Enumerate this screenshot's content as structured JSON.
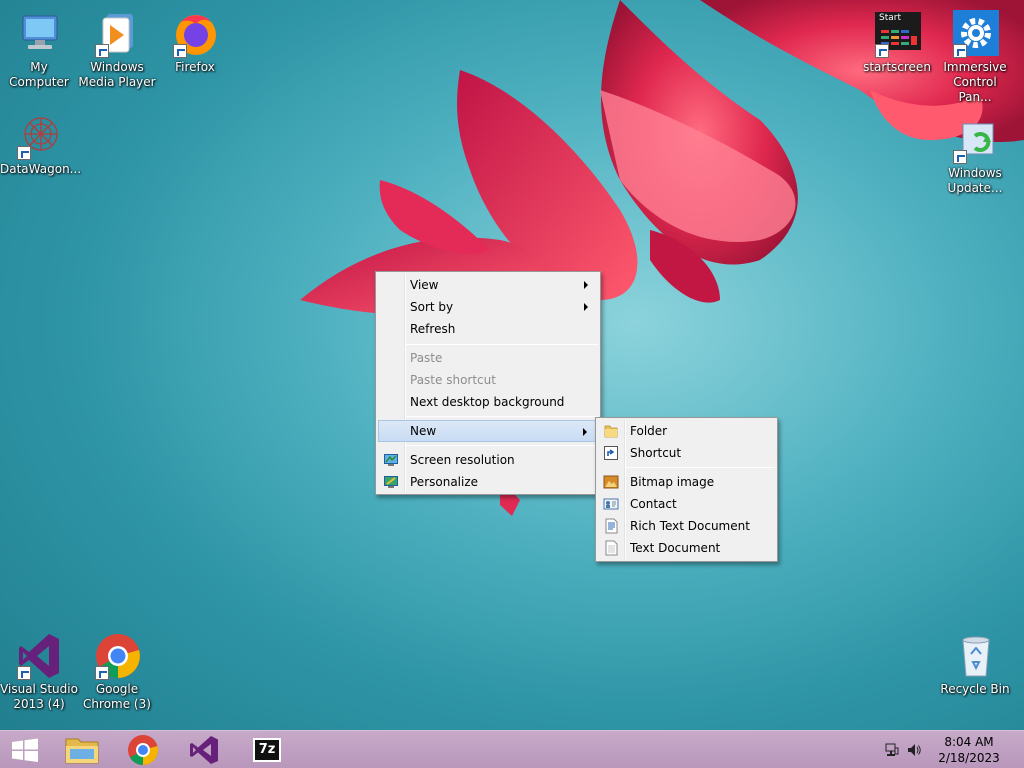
{
  "desktop": {
    "icons": [
      {
        "name": "my-computer",
        "label": "My Computer"
      },
      {
        "name": "windows-media-player",
        "label": "Windows Media Player"
      },
      {
        "name": "firefox",
        "label": "Firefox"
      },
      {
        "name": "datawagon",
        "label": "DataWagon..."
      },
      {
        "name": "startscreen",
        "label": "startscreen",
        "tile_text": "Start"
      },
      {
        "name": "immersive-control-panel",
        "label": "Immersive Control Pan..."
      },
      {
        "name": "windows-update",
        "label": "Windows Update..."
      },
      {
        "name": "visual-studio",
        "label": "Visual Studio 2013 (4)"
      },
      {
        "name": "google-chrome",
        "label": "Google Chrome (3)"
      },
      {
        "name": "recycle-bin",
        "label": "Recycle Bin"
      }
    ]
  },
  "context_menu": {
    "items": [
      {
        "label": "View",
        "submenu": true
      },
      {
        "label": "Sort by",
        "submenu": true
      },
      {
        "label": "Refresh"
      },
      {
        "label": "Paste",
        "disabled": true
      },
      {
        "label": "Paste shortcut",
        "disabled": true
      },
      {
        "label": "Next desktop background"
      },
      {
        "label": "New",
        "submenu": true,
        "highlighted": true
      },
      {
        "label": "Screen resolution",
        "icon": "display-icon"
      },
      {
        "label": "Personalize",
        "icon": "personalize-icon"
      }
    ]
  },
  "new_submenu": {
    "items": [
      {
        "label": "Folder",
        "icon": "folder-icon"
      },
      {
        "label": "Shortcut",
        "icon": "shortcut-icon"
      },
      {
        "label": "Bitmap image",
        "icon": "bitmap-icon"
      },
      {
        "label": "Contact",
        "icon": "contact-icon"
      },
      {
        "label": "Rich Text Document",
        "icon": "rich-text-icon"
      },
      {
        "label": "Text Document",
        "icon": "text-document-icon"
      }
    ]
  },
  "taskbar": {
    "pinned": [
      "start-button",
      "file-explorer",
      "google-chrome",
      "visual-studio",
      "7-zip"
    ],
    "sevenzip_label": "7z",
    "clock": {
      "time": "8:04 AM",
      "date": "2/18/2023"
    }
  },
  "colors": {
    "taskbar": "#c0a0c3",
    "desktop_teal": "#3aa3b3",
    "flower": "#d8284f",
    "menu_bg": "#f0f0f0",
    "highlight": "#cfe0f5"
  }
}
